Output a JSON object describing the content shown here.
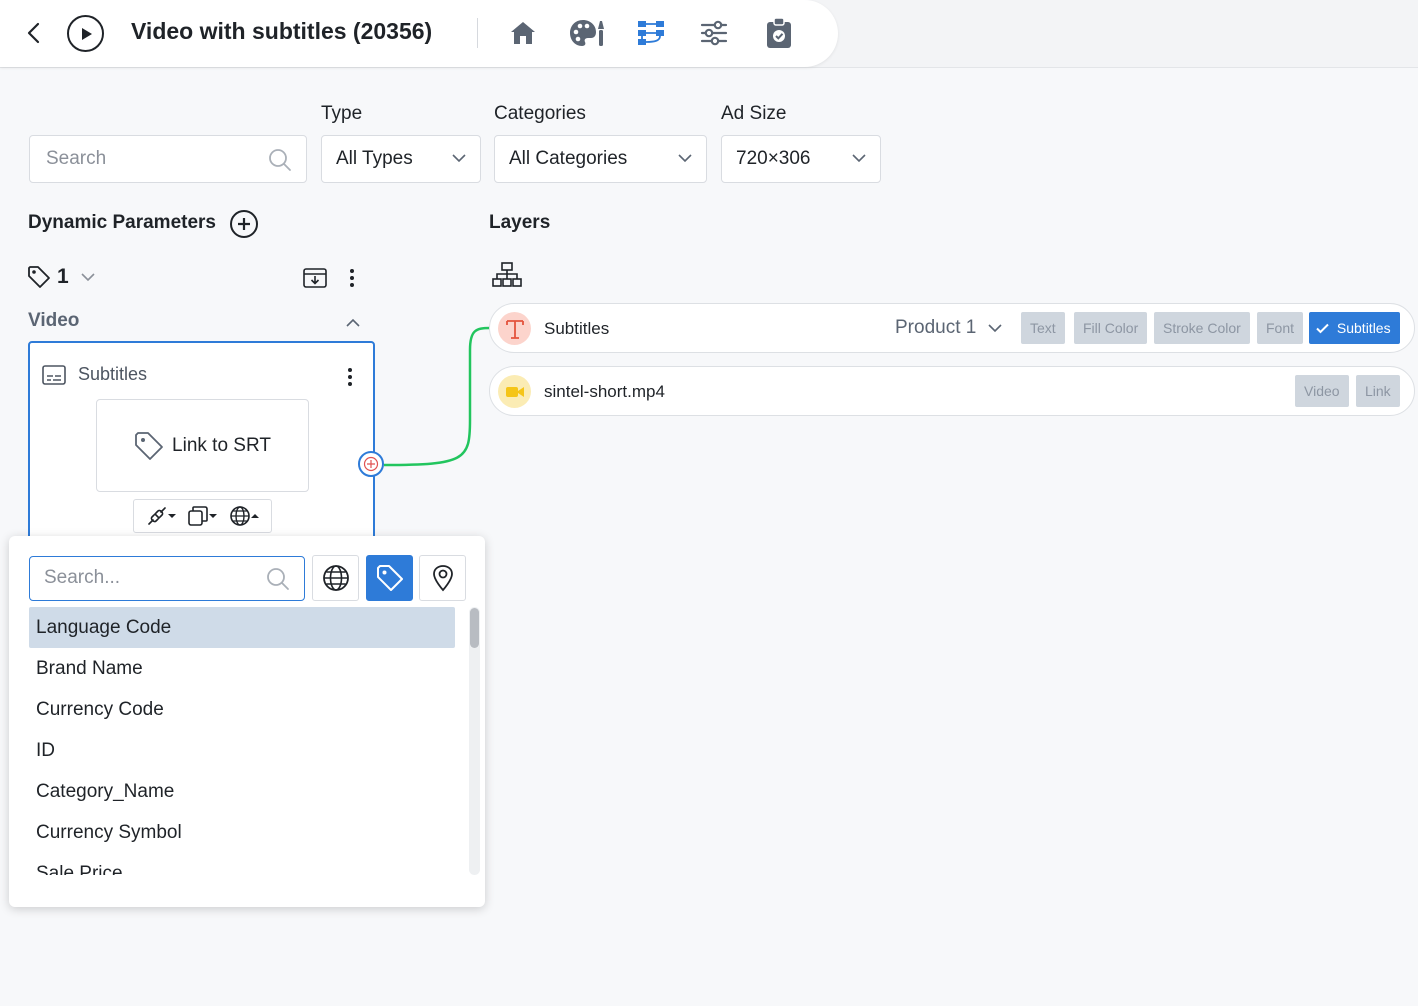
{
  "header": {
    "title": "Video with subtitles (20356)",
    "icons": [
      "back-chevron-icon",
      "play-icon",
      "home-icon",
      "palette-icon",
      "workflow-icon",
      "sliders-icon",
      "clipboard-check-icon"
    ],
    "active_icon_color": "#2e7bd8",
    "icon_color": "#5b6573"
  },
  "filters": {
    "search_placeholder": "Search",
    "type_label": "Type",
    "type_value": "All Types",
    "categories_label": "Categories",
    "categories_value": "All Categories",
    "adsize_label": "Ad Size",
    "adsize_value": "720×306"
  },
  "dynamic_params": {
    "title": "Dynamic Parameters",
    "tag_count": "1",
    "group_label": "Video",
    "card": {
      "title": "Subtitles",
      "link_label": "Link to SRT"
    }
  },
  "dropdown": {
    "search_placeholder": "Search...",
    "items": [
      "Language Code",
      "Brand Name",
      "Currency Code",
      "ID",
      "Category_Name",
      "Currency Symbol",
      "Sale Price"
    ],
    "selected_index": 0
  },
  "layers": {
    "title": "Layers",
    "rows": [
      {
        "name": "Subtitles",
        "icon": "text-layer-icon",
        "product": "Product 1",
        "chips": [
          "Text",
          "Fill Color",
          "Stroke Color",
          "Font",
          "Subtitles"
        ],
        "active_chip": "Subtitles"
      },
      {
        "name": "sintel-short.mp4",
        "icon": "video-layer-icon",
        "chips": [
          "Video",
          "Link"
        ]
      }
    ]
  },
  "colors": {
    "accent": "#2e7bd8",
    "link_line": "#22c55e",
    "chip_bg": "#cfd6de",
    "selected_item": "#cfdbe8"
  }
}
